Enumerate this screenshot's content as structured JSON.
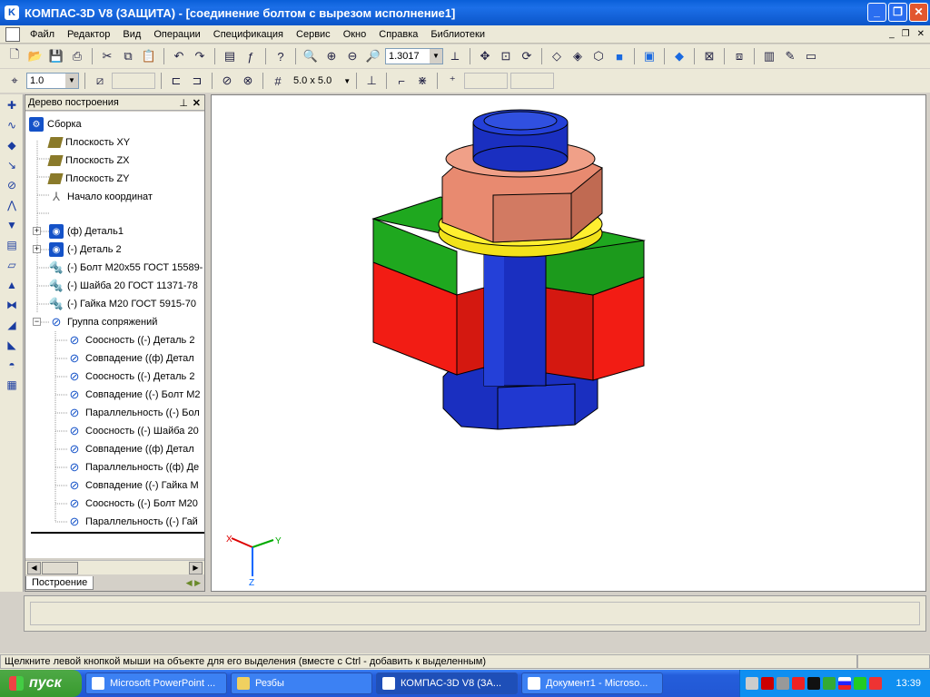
{
  "window": {
    "title": "КОМПАС-3D V8 (ЗАЩИТА) - [соединение болтом с вырезом исполнение1]"
  },
  "menu": {
    "items": [
      "Файл",
      "Редактор",
      "Вид",
      "Операции",
      "Спецификация",
      "Сервис",
      "Окно",
      "Справка",
      "Библиотеки"
    ]
  },
  "toolbar": {
    "zoom_value": "1.3017",
    "line_width": "1.0",
    "grid_step": "5.0 x 5.0"
  },
  "tree": {
    "header": "Дерево построения",
    "tab": "Построение",
    "nodes": [
      {
        "label": "Сборка",
        "icon": "assembly-icon"
      },
      {
        "label": "Плоскость XY",
        "icon": "plane-icon"
      },
      {
        "label": "Плоскость ZX",
        "icon": "plane-icon"
      },
      {
        "label": "Плоскость ZY",
        "icon": "plane-icon"
      },
      {
        "label": "Начало координат",
        "icon": "origin-icon"
      },
      {
        "label": "(ф) Деталь1",
        "icon": "part-icon"
      },
      {
        "label": "(-) Деталь 2",
        "icon": "part-icon"
      },
      {
        "label": "(-) Болт М20х55 ГОСТ 15589-",
        "icon": "standard-part-icon"
      },
      {
        "label": "(-) Шайба 20 ГОСТ 11371-78",
        "icon": "standard-part-icon"
      },
      {
        "label": "(-) Гайка М20 ГОСТ 5915-70",
        "icon": "standard-part-icon"
      },
      {
        "label": "Группа сопряжений",
        "icon": "mates-group-icon"
      },
      {
        "label": "Соосность ((-) Деталь 2",
        "icon": "mate-icon"
      },
      {
        "label": "Совпадение ((ф) Детал",
        "icon": "mate-icon"
      },
      {
        "label": "Соосность ((-) Деталь 2",
        "icon": "mate-icon"
      },
      {
        "label": "Совпадение ((-) Болт М2",
        "icon": "mate-icon"
      },
      {
        "label": "Параллельность ((-) Бол",
        "icon": "mate-icon"
      },
      {
        "label": "Соосность ((-) Шайба 20",
        "icon": "mate-icon"
      },
      {
        "label": "Совпадение ((ф) Детал",
        "icon": "mate-icon"
      },
      {
        "label": "Параллельность ((ф) Де",
        "icon": "mate-icon"
      },
      {
        "label": "Совпадение ((-) Гайка М",
        "icon": "mate-icon"
      },
      {
        "label": "Соосность ((-) Болт М20",
        "icon": "mate-icon"
      },
      {
        "label": "Параллельность ((-) Гай",
        "icon": "mate-icon"
      }
    ]
  },
  "axes": {
    "x": "X",
    "y": "Y",
    "z": "Z"
  },
  "status": {
    "message": "Щелкните левой кнопкой мыши на объекте для его выделения (вместе с Ctrl - добавить к выделенным)"
  },
  "taskbar": {
    "start": "пуск",
    "tasks": [
      "Microsoft PowerPoint ...",
      "Резбы",
      "КОМПАС-3D V8 (ЗА...",
      "Документ1 - Microso..."
    ],
    "clock": "13:39"
  },
  "colors": {
    "bolt": "#1a2fc0",
    "green_plate": "#1fa81f",
    "red_plate": "#f21c14",
    "nut": "#e88a70",
    "washer": "#f2e21a"
  }
}
